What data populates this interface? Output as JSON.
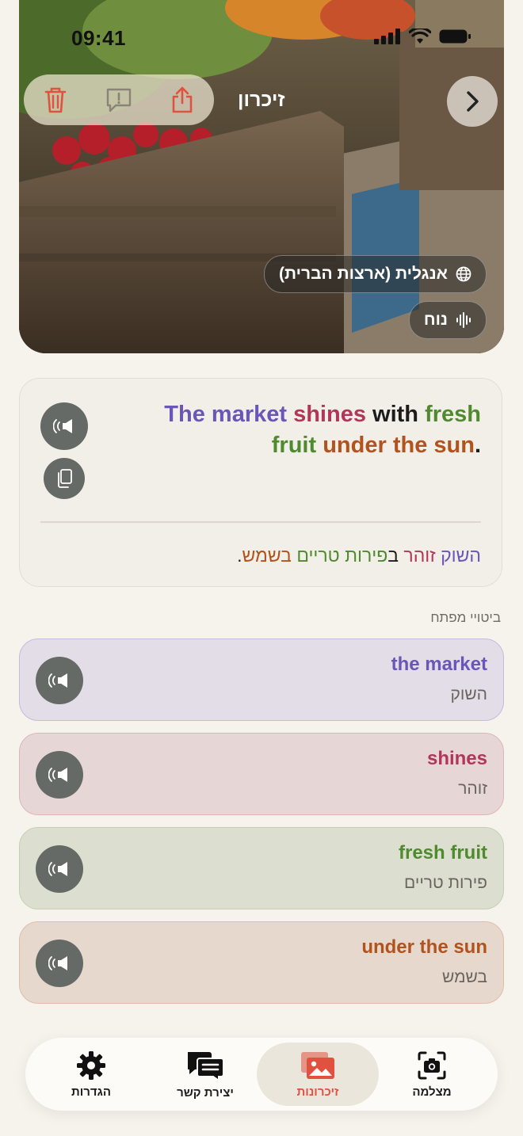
{
  "status_bar": {
    "time": "09:41"
  },
  "header": {
    "title": "זיכרון"
  },
  "toolbar": {
    "delete_icon": "trash-icon",
    "report_icon": "report-icon",
    "share_icon": "share-icon",
    "next_icon": "chevron-right-icon"
  },
  "hero": {
    "language": "אנגלית (ארצות הברית)",
    "voice": "נוח"
  },
  "sentence": {
    "english_parts": [
      {
        "text": "The market",
        "color": "#6a55b8"
      },
      {
        "text": " ",
        "color": "#1c1c1c"
      },
      {
        "text": "shines",
        "color": "#b0365a"
      },
      {
        "text": " with ",
        "color": "#1c1c1c"
      },
      {
        "text": "fresh fruit",
        "color": "#4f8a2e"
      },
      {
        "text": " ",
        "color": "#1c1c1c"
      },
      {
        "text": "under the sun",
        "color": "#b2521c"
      },
      {
        "text": ".",
        "color": "#1c1c1c"
      }
    ],
    "hebrew_parts": [
      {
        "text": "השוק",
        "color": "#6a55b8"
      },
      {
        "text": " ",
        "color": "#1c1c1c"
      },
      {
        "text": "זוהר",
        "color": "#b0365a"
      },
      {
        "text": " ב",
        "color": "#1c1c1c"
      },
      {
        "text": "פירות טריים",
        "color": "#4f8a2e"
      },
      {
        "text": " ",
        "color": "#1c1c1c"
      },
      {
        "text": "בשמש",
        "color": "#b2521c"
      },
      {
        "text": ".",
        "color": "#1c1c1c"
      }
    ]
  },
  "key_phrases": {
    "label": "ביטויי מפתח",
    "items": [
      {
        "en": "the market",
        "he": "השוק",
        "color": "#6a55b8",
        "bg": "#e2dde6",
        "border": "#c4bbe0"
      },
      {
        "en": "shines",
        "he": "זוהר",
        "color": "#b0365a",
        "bg": "#e6d7d6",
        "border": "#e0b3bb"
      },
      {
        "en": "fresh fruit",
        "he": "פירות טריים",
        "color": "#4f8a2e",
        "bg": "#dcdfd0",
        "border": "#c2d1b4"
      },
      {
        "en": "under the sun",
        "he": "בשמש",
        "color": "#b2521c",
        "bg": "#e6d8cc",
        "border": "#e1bda6"
      }
    ]
  },
  "nav": {
    "items": [
      {
        "label": "הגדרות",
        "icon": "gear-icon"
      },
      {
        "label": "יצירת קשר",
        "icon": "chat-icon"
      },
      {
        "label": "זיכרונות",
        "icon": "photos-icon",
        "active": true
      },
      {
        "label": "מצלמה",
        "icon": "camera-icon"
      }
    ]
  }
}
